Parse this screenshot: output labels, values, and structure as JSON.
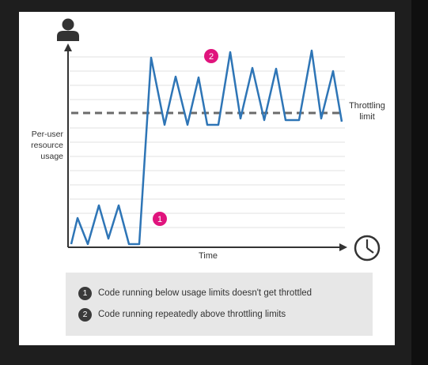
{
  "y_axis_label": [
    "Per-user",
    "resource",
    "usage"
  ],
  "x_axis_label": "Time",
  "throttling_limit_label": [
    "Throttling",
    "limit"
  ],
  "callout_1": "1",
  "callout_2": "2",
  "legend": [
    {
      "number": "1",
      "text": "Code running below usage limits doesn't get throttled"
    },
    {
      "number": "2",
      "text": "Code running repeatedly above throttling limits"
    }
  ],
  "colors": {
    "line": "#2e75b6",
    "callout": "#e0147d",
    "axis": "#333333",
    "dashed_limit": "#6b6b6b",
    "legend_bg": "#e7e7e7",
    "legend_number": "#3a3a3a"
  },
  "icons": [
    "user-icon",
    "clock-icon"
  ]
}
